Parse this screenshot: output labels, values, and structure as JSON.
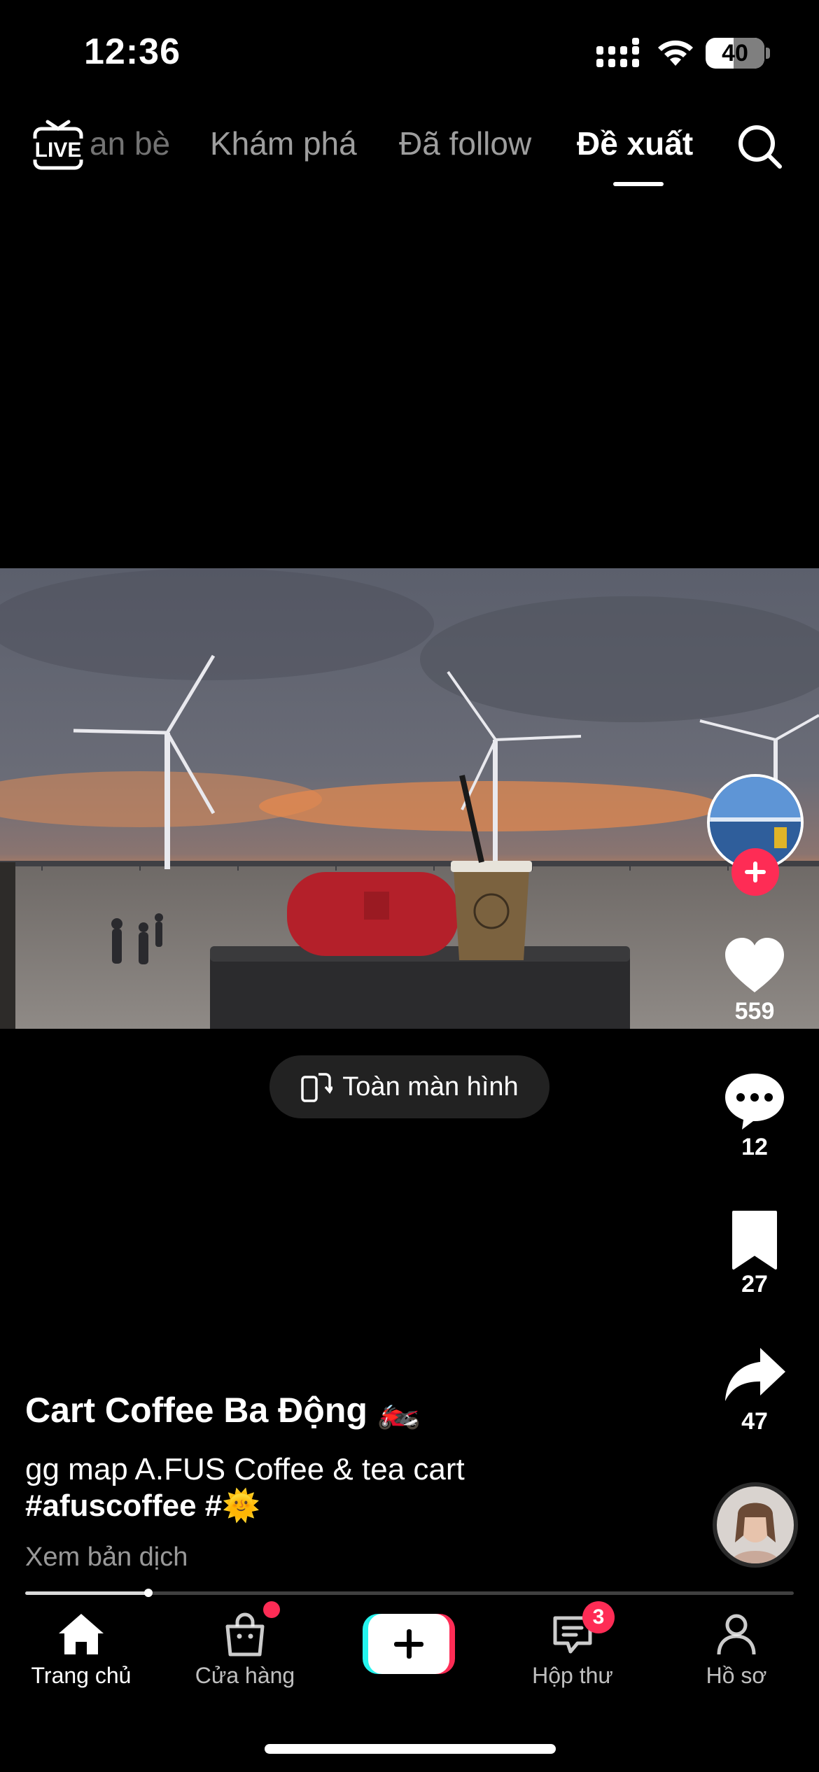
{
  "status_bar": {
    "time": "12:36",
    "battery": "40"
  },
  "top_nav": {
    "live_label": "LIVE",
    "tabs": [
      {
        "label": "Bạn bè",
        "visible_text": "an bè"
      },
      {
        "label": "Khám phá"
      },
      {
        "label": "Đã follow"
      },
      {
        "label": "Đề xuất",
        "active": true
      }
    ]
  },
  "video": {
    "fullscreen_label": "Toàn màn hình"
  },
  "actions": {
    "likes": "559",
    "comments": "12",
    "saves": "27",
    "shares": "47"
  },
  "post": {
    "username": "Cart Coffee Ba Động 🏍️",
    "caption": "gg map A.FUS Coffee & tea cart",
    "hashtags": "#afuscoffee #🌞",
    "translate_label": "Xem bản dịch",
    "progress": 0.16
  },
  "bottom_nav": {
    "home": "Trang chủ",
    "shop": "Cửa hàng",
    "inbox": "Hộp thư",
    "inbox_badge": "3",
    "profile": "Hồ sơ"
  },
  "colors": {
    "accent": "#fe2c55",
    "cyan": "#25f4ee"
  },
  "icons": [
    "live-icon",
    "search-icon",
    "heart-icon",
    "comment-icon",
    "bookmark-icon",
    "share-icon",
    "home-icon",
    "shop-bag-icon",
    "plus-icon",
    "inbox-icon",
    "profile-icon"
  ]
}
